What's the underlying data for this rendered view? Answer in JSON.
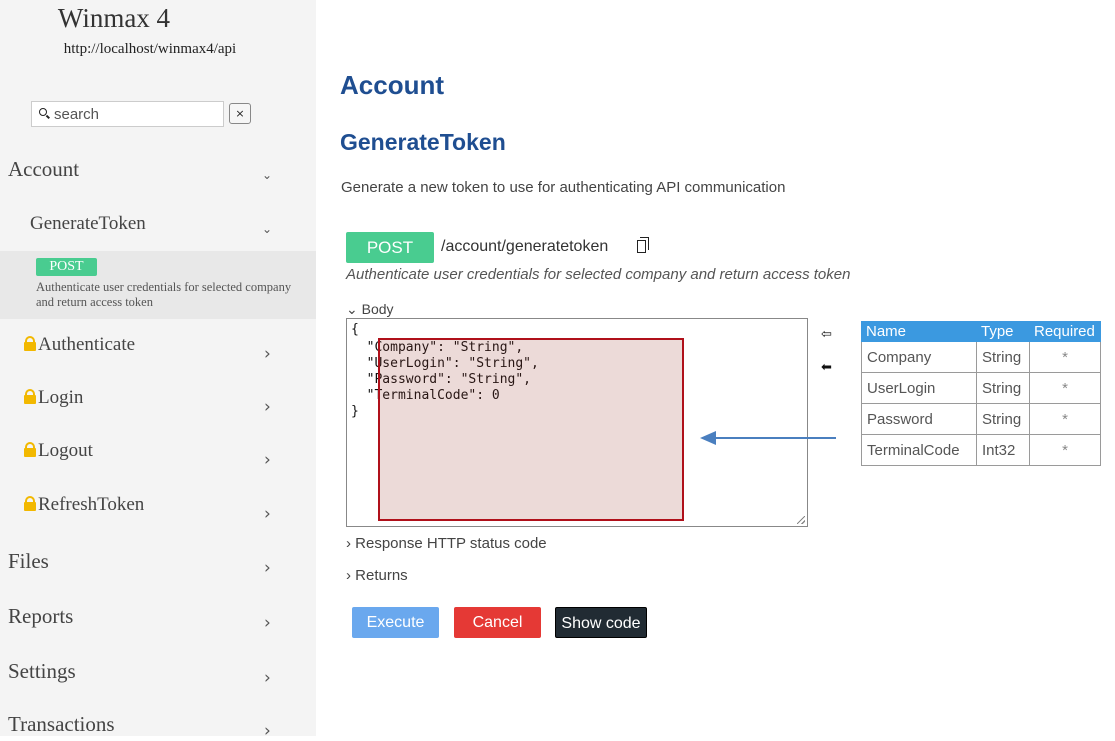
{
  "sidebar": {
    "app_title": "Winmax 4",
    "app_url": "http://localhost/winmax4/api",
    "search": {
      "placeholder": "search",
      "clear_label": "×"
    },
    "account": {
      "label": "Account",
      "chevron": "⌄"
    },
    "generate_token": {
      "label": "GenerateToken",
      "chevron": "⌄"
    },
    "selected_method": "POST",
    "selected_desc": "Authenticate user credentials for selected company and return access token",
    "items": [
      {
        "label": "Authenticate",
        "chevron": "›"
      },
      {
        "label": "Login",
        "chevron": "›"
      },
      {
        "label": "Logout",
        "chevron": "›"
      },
      {
        "label": "RefreshToken",
        "chevron": "›"
      }
    ],
    "sections": [
      {
        "label": "Files",
        "chevron": "›"
      },
      {
        "label": "Reports",
        "chevron": "›"
      },
      {
        "label": "Settings",
        "chevron": "›"
      },
      {
        "label": "Transactions",
        "chevron": "›"
      }
    ]
  },
  "main": {
    "section_title": "Account",
    "endpoint_title": "GenerateToken",
    "description": "Generate a new token to use for authenticating API communication",
    "method": "POST",
    "path": "/account/generatetoken",
    "endpoint_desc": "Authenticate user credentials for selected company and return access token",
    "body_toggle": "⌄ Body",
    "body_lines": [
      "{",
      "  \"Company\": \"String\",",
      "  \"UserLogin\": \"String\",",
      "  \"Password\": \"String\",",
      "  \"TerminalCode\": 0",
      "}"
    ],
    "arrow_up": "⇦",
    "arrow_down": "⬅",
    "response_toggle": "› Response HTTP status code",
    "returns_toggle": "› Returns",
    "params_table": {
      "headers": [
        "Name",
        "Type",
        "Required"
      ],
      "rows": [
        [
          "Company",
          "String",
          "*"
        ],
        [
          "UserLogin",
          "String",
          "*"
        ],
        [
          "Password",
          "String",
          "*"
        ],
        [
          "TerminalCode",
          "Int32",
          "*"
        ]
      ]
    },
    "buttons": {
      "execute": "Execute",
      "cancel": "Cancel",
      "show_code": "Show code"
    }
  },
  "colors": {
    "post": "#49cc90",
    "title": "#1f4e91",
    "table_header": "#3b99e0",
    "execute": "#6aa8ee",
    "cancel": "#e53935",
    "show_code": "#212b33",
    "highlight_border": "#b0101a",
    "annotation_arrow": "#4a7fbf"
  },
  "icons": [
    "search-icon",
    "close-icon",
    "chevron-down-icon",
    "chevron-right-icon",
    "lock-icon",
    "copy-icon",
    "arrow-left-outline-icon",
    "arrow-left-solid-icon"
  ]
}
